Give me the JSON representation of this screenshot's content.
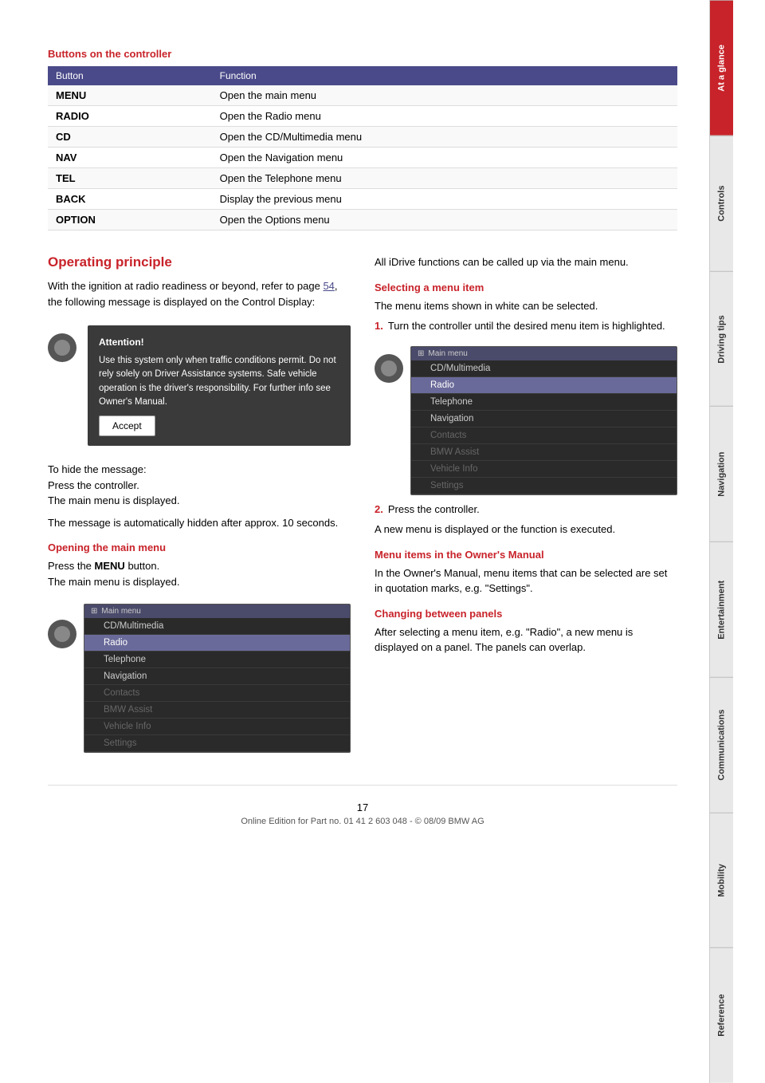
{
  "sidebar": {
    "tabs": [
      {
        "label": "At a glance",
        "active": true
      },
      {
        "label": "Controls",
        "active": false
      },
      {
        "label": "Driving tips",
        "active": false
      },
      {
        "label": "Navigation",
        "active": false
      },
      {
        "label": "Entertainment",
        "active": false
      },
      {
        "label": "Communications",
        "active": false
      },
      {
        "label": "Mobility",
        "active": false
      },
      {
        "label": "Reference",
        "active": false
      }
    ]
  },
  "buttons_table": {
    "section_heading": "Buttons on the controller",
    "col_button": "Button",
    "col_function": "Function",
    "rows": [
      {
        "button": "MENU",
        "function": "Open the main menu"
      },
      {
        "button": "RADIO",
        "function": "Open the Radio menu"
      },
      {
        "button": "CD",
        "function": "Open the CD/Multimedia menu"
      },
      {
        "button": "NAV",
        "function": "Open the Navigation menu"
      },
      {
        "button": "TEL",
        "function": "Open the Telephone menu"
      },
      {
        "button": "BACK",
        "function": "Display the previous menu"
      },
      {
        "button": "OPTION",
        "function": "Open the Options menu"
      }
    ]
  },
  "operating_principle": {
    "title": "Operating principle",
    "intro_text": "With the ignition at radio readiness or beyond, refer to page",
    "page_ref": "54",
    "intro_text2": ", the following message is displayed on the Control Display:",
    "attention": {
      "title": "Attention!",
      "body": "Use this system only when traffic conditions permit. Do not rely solely on Driver Assistance systems. Safe vehicle operation is the driver's responsibility. For further info see Owner's Manual.",
      "accept_label": "Accept"
    },
    "hide_message_text": "To hide the message:\nPress the controller.\nThe main menu is displayed.",
    "auto_hidden_text": "The message is automatically hidden after approx. 10 seconds.",
    "opening_main_menu": {
      "heading": "Opening the main menu",
      "text": "Press the",
      "bold_word": "MENU",
      "text2": "button.\nThe main menu is displayed."
    },
    "main_menu_items": [
      {
        "label": "CD/Multimedia",
        "state": "normal"
      },
      {
        "label": "Radio",
        "state": "highlighted"
      },
      {
        "label": "Telephone",
        "state": "normal"
      },
      {
        "label": "Navigation",
        "state": "normal"
      },
      {
        "label": "Contacts",
        "state": "dimmed"
      },
      {
        "label": "BMW Assist",
        "state": "dimmed"
      },
      {
        "label": "Vehicle Info",
        "state": "dimmed"
      },
      {
        "label": "Settings",
        "state": "dimmed"
      }
    ],
    "main_menu_title": "Main menu"
  },
  "right_col": {
    "all_functions_text": "All iDrive functions can be called up via the main menu.",
    "selecting_menu_item": {
      "heading": "Selecting a menu item",
      "text": "The menu items shown in white can be selected.",
      "step1": {
        "num": "1.",
        "text": "Turn the controller until the desired menu item is highlighted."
      },
      "step2": {
        "num": "2.",
        "text": "Press the controller."
      },
      "result_text": "A new menu is displayed or the function is executed."
    },
    "menu_items_owners": {
      "heading": "Menu items in the Owner's Manual",
      "text": "In the Owner's Manual, menu items that can be selected are set in quotation marks, e.g. \"Settings\"."
    },
    "changing_panels": {
      "heading": "Changing between panels",
      "text": "After selecting a menu item, e.g. \"Radio\", a new menu is displayed on a panel. The panels can overlap."
    }
  },
  "footer": {
    "page_number": "17",
    "footer_text": "Online Edition for Part no. 01 41 2 603 048 - © 08/09 BMW AG"
  }
}
